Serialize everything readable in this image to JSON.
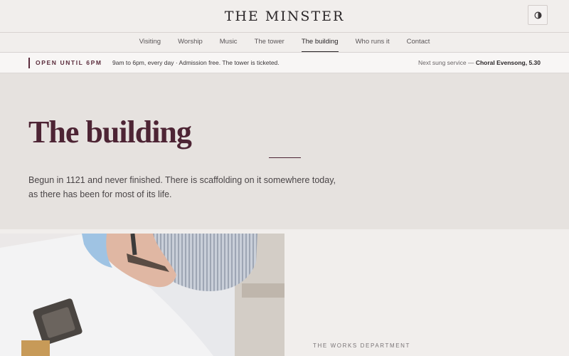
{
  "header": {
    "site_title": "THE MINSTER",
    "theme_toggle_icon": "contrast-icon"
  },
  "nav": {
    "items": [
      {
        "label": "Visiting"
      },
      {
        "label": "Worship"
      },
      {
        "label": "Music"
      },
      {
        "label": "The tower"
      },
      {
        "label": "The building",
        "active": true
      },
      {
        "label": "Who runs it"
      },
      {
        "label": "Contact"
      }
    ]
  },
  "infobar": {
    "open_label": "OPEN UNTIL 6PM",
    "hours": "9am to 6pm, every day · Admission free. The tower is ticketed.",
    "next_service_prefix": "Next sung service —",
    "next_service_name": "Choral Evensong, 5.30"
  },
  "hero": {
    "title": "The building",
    "lede": "Begun in 1121 and never finished. There is scaffolding on it somewhere today, as there has been for most of its life."
  },
  "section": {
    "image_subject": "stonemason-with-mallet-and-chisel",
    "eyebrow": "THE WORKS DEPARTMENT"
  },
  "colors": {
    "accent": "#5b2c3c",
    "hero_bg": "#e6e2df",
    "page_bg": "#f1eeec"
  }
}
